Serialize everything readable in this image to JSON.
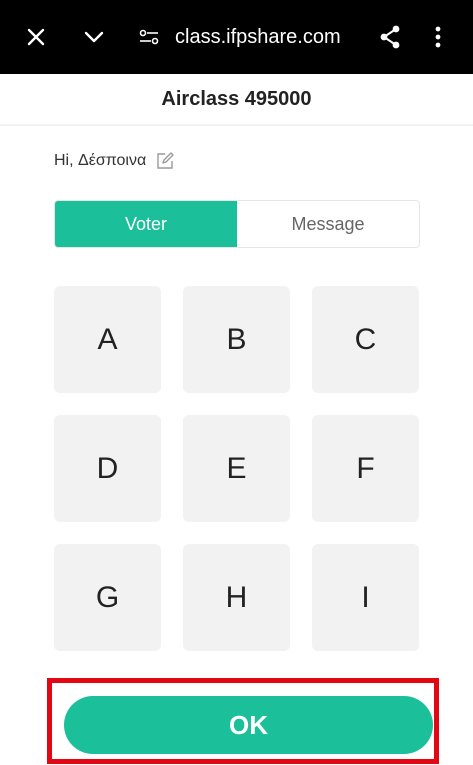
{
  "browser": {
    "url": "class.ifpshare.com"
  },
  "page": {
    "title": "Airclass 495000",
    "greeting": "Hi, Δέσποινα"
  },
  "tabs": [
    {
      "label": "Voter",
      "active": true
    },
    {
      "label": "Message",
      "active": false
    }
  ],
  "options": [
    "A",
    "B",
    "C",
    "D",
    "E",
    "F",
    "G",
    "H",
    "I"
  ],
  "ok_button": {
    "label": "OK"
  },
  "colors": {
    "accent": "#1bbf9a",
    "highlight_frame": "#e30613",
    "topbar": "#000000",
    "option_bg": "#f2f2f2"
  }
}
